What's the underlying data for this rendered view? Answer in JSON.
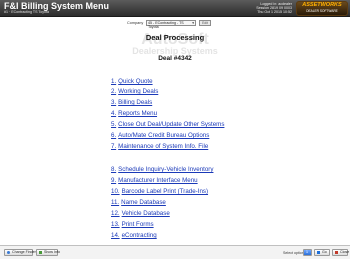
{
  "titlebar": {
    "title": "F&I Billing System Menu",
    "subtitle": "#1 · EContracting  TS Toyota",
    "info_user": "Logged in: acdealer",
    "info_session": "Session 2819 09 0003",
    "info_datetime": "Thu Oct 1 2015 10:52",
    "logo_line1": "ASSETWORKS",
    "logo_line2": "DEALER SOFTWARE"
  },
  "company_bar": {
    "label": "Company",
    "selected": "45 - EContracting - TS Toyota",
    "edit_label": "Edit"
  },
  "watermark": {
    "line1": "AutoSoft",
    "line2": "Dealership Systems"
  },
  "heading": "Deal Processing",
  "deal_number": "Deal #4342",
  "menu": [
    {
      "num": "1.",
      "label": "Quick Quote"
    },
    {
      "num": "2.",
      "label": "Working Deals"
    },
    {
      "num": "3.",
      "label": "Billing Deals"
    },
    {
      "num": "4.",
      "label": "Reports Menu"
    },
    {
      "num": "5.",
      "label": "Close Out Deal/Update Other Systems"
    },
    {
      "num": "6.",
      "label": "Auto/Mate Credit Bureau Options"
    },
    {
      "num": "7.",
      "label": "Maintenance of System Info. File"
    },
    {
      "num": "8.",
      "label": "Schedule Inquiry-Vehicle Inventory"
    },
    {
      "num": "9.",
      "label": "Manufacturer Interface Menu"
    },
    {
      "num": "10.",
      "label": "Barcode Label Print (Trade-Ins)"
    },
    {
      "num": "11.",
      "label": "Name Database"
    },
    {
      "num": "12.",
      "label": "Vehicle Database"
    },
    {
      "num": "13.",
      "label": "Print Forms"
    },
    {
      "num": "14.",
      "label": "eContracting"
    }
  ],
  "bottombar": {
    "change_finder": "Change Finder",
    "show_info": "Show Info",
    "select_label": "Select option:",
    "select_value": "1",
    "go": "Go",
    "close": "Close"
  },
  "colors": {
    "titlebar": "#3a3a3a",
    "link": "#1a39b8",
    "logo_accent": "#ffb000"
  }
}
